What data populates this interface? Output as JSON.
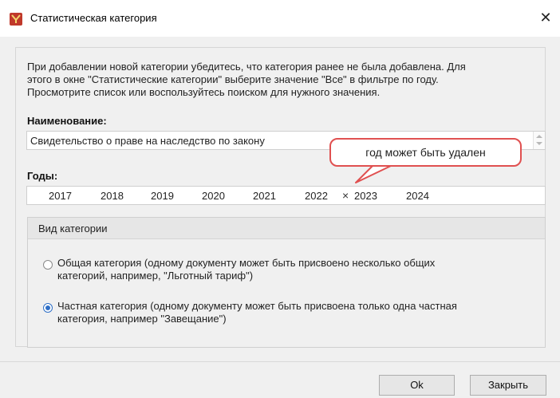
{
  "window": {
    "title": "Статистическая категория",
    "close_glyph": "✕"
  },
  "info": {
    "line1": "При добавлении новой категории убедитесь, что категория ранее не была добавлена. Для",
    "line2": "этого в окне \"Статистические категории\" выберите значение \"Все\" в фильтре по году.",
    "line3": "Просмотрите список или воспользуйтесь поиском для нужного значения."
  },
  "name_field": {
    "label": "Наименование:",
    "value": "Свидетельство о праве на наследство по закону"
  },
  "callout": {
    "text": "год может быть удален",
    "border_color": "#e05050"
  },
  "years_field": {
    "label": "Годы:",
    "years": [
      "2017",
      "2018",
      "2019",
      "2020",
      "2021",
      "2022",
      "2023",
      "2024"
    ],
    "remove_glyph": "×"
  },
  "category_group": {
    "header": "Вид категории",
    "options": [
      {
        "line1": "Общая категория (одному документу может быть присвоено несколько общих",
        "line2": "категорий, например, \"Льготный тариф\")",
        "selected": false
      },
      {
        "line1": "Частная категория (одному документу может быть присвоена только одна частная",
        "line2": "категория, например \"Завещание\")",
        "selected": true
      }
    ]
  },
  "buttons": {
    "ok": "Ok",
    "close": "Закрыть"
  },
  "colors": {
    "accent": "#2f6fc6",
    "app_icon": "#c0392b"
  }
}
